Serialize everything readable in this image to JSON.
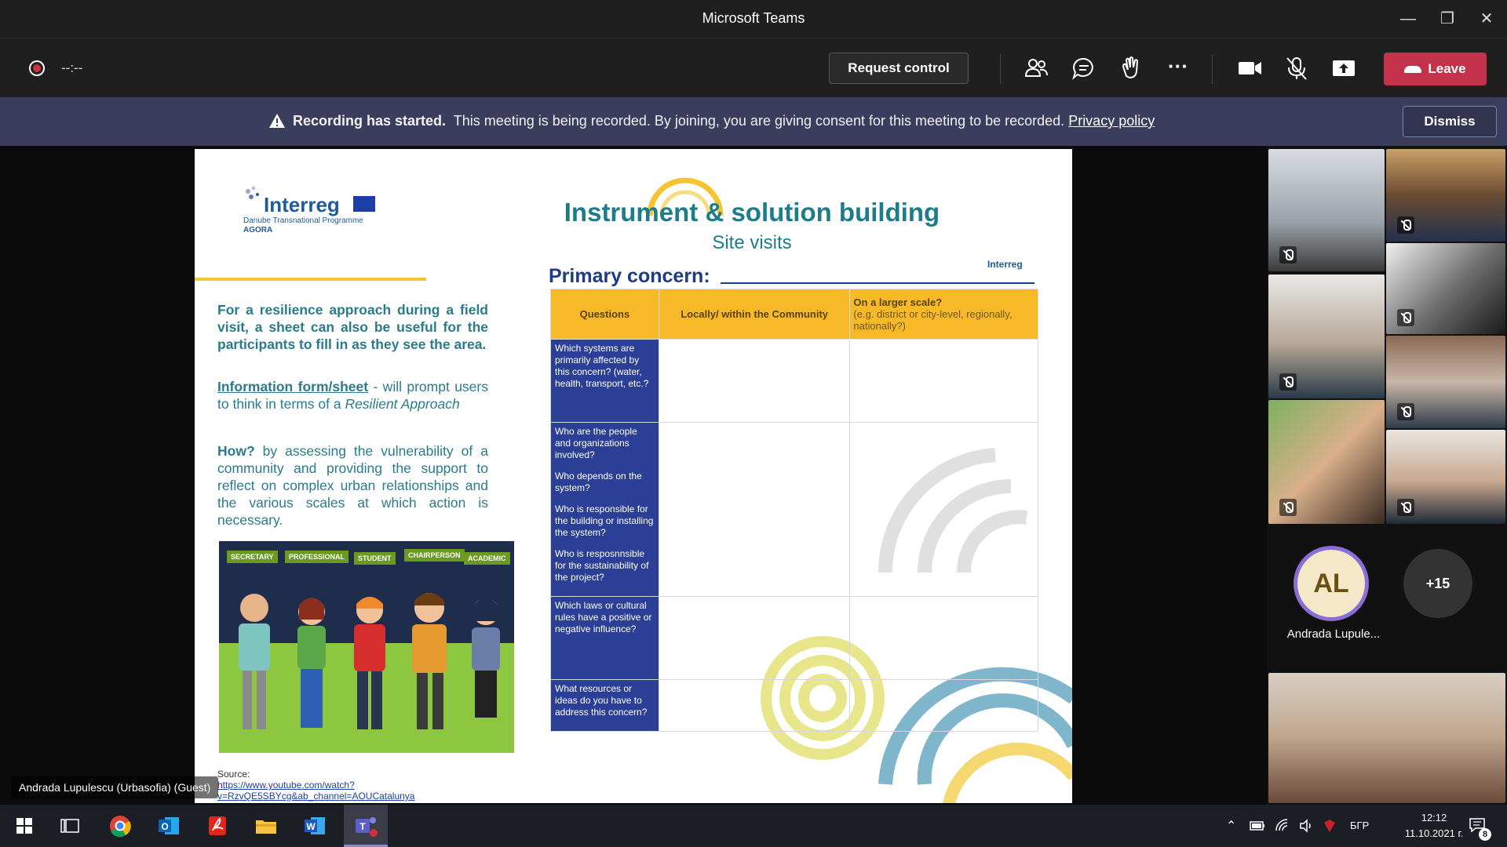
{
  "window": {
    "title": "Microsoft Teams"
  },
  "toolbar": {
    "timer": "--:--",
    "request_control": "Request control",
    "leave": "Leave"
  },
  "banner": {
    "bold": "Recording has started.",
    "text": "This meeting is being recorded. By joining, you are giving consent for this meeting to be recorded.",
    "link": "Privacy policy",
    "dismiss": "Dismiss"
  },
  "presenter": {
    "name": "Andrada Lupulescu (Urbasofia) (Guest)"
  },
  "slide": {
    "logo_word": "Interreg",
    "logo_sub": "Danube Transnational Programme",
    "logo_sub2": "AGORA",
    "mini_logo": "Interreg",
    "title": "Instrument & solution building",
    "subtitle": "Site visits",
    "primary_concern": "Primary concern:",
    "p1": "For a resilience approach during a field visit, a sheet can also be useful for the participants to fill in as they see the area.",
    "p2_link": "Information form/sheet",
    "p2_text": " - will prompt users to think in terms of a ",
    "p2_em": "Resilient Approach",
    "p3_bold": "How?",
    "p3_text": " by assessing the vulnerability of a community and providing the support to reflect on complex urban relationships and the various scales at which action is necessary.",
    "source_label": "Source:",
    "source_link": "https://www.youtube.com/watch?v=RzvQE5SBYcg&ab_channel=AOUCatalunya",
    "people_labels": [
      "SECRETARY",
      "PROFESSIONAL",
      "STUDENT",
      "CHAIRPERSON",
      "ACADEMIC"
    ],
    "table": {
      "headers": [
        "Questions",
        "Locally/ within the Community",
        "On a larger scale?"
      ],
      "header_note": "(e.g. district or city-level, regionally, nationally?)",
      "rows": [
        [
          "Which systems are primarily affected by this concern? (water, health, transport, etc.?"
        ],
        [
          "Who are the people and organizations involved?",
          "Who depends on the system?",
          "Who is responsible for the building or installing the system?",
          "Who is resposnnsible for the sustainability of the project?"
        ],
        [
          "Which laws or cultural rules have a positive or negative influence?"
        ],
        [
          "What resources or ideas do you have to address this concern?"
        ]
      ]
    }
  },
  "gallery": {
    "avatar_initials": "AL",
    "avatar_name": "Andrada Lupule...",
    "more": "+15"
  },
  "taskbar": {
    "lang": "БГР",
    "time": "12:12",
    "date": "11.10.2021 г.",
    "notif_count": "8"
  }
}
